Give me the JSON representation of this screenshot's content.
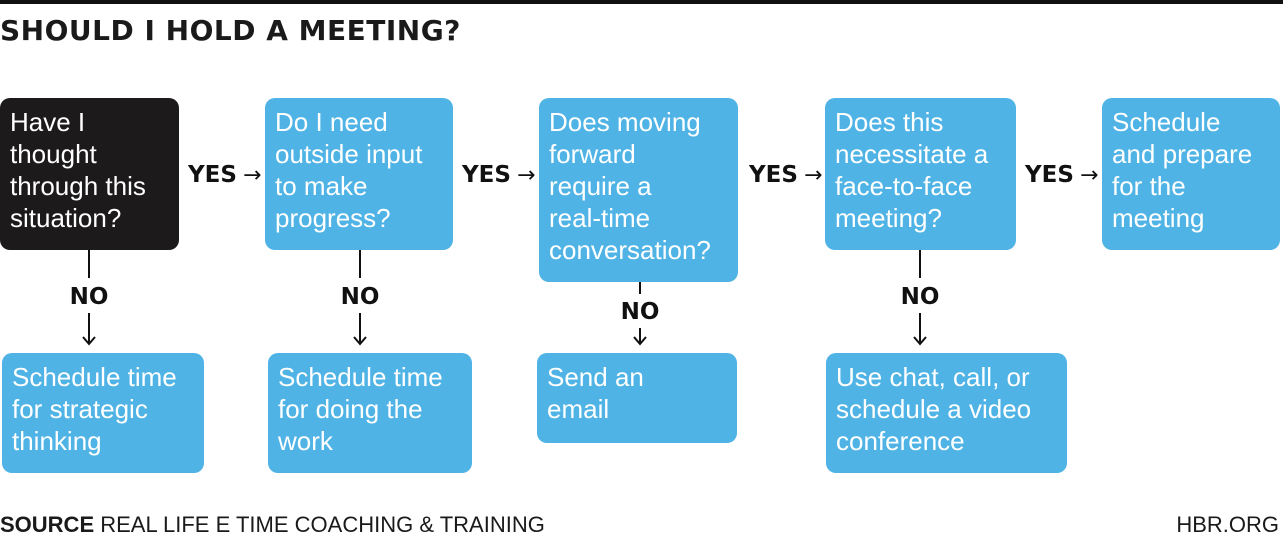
{
  "title": "SHOULD I HOLD A MEETING?",
  "colors": {
    "question_primary": "#1c1a1a",
    "box": "#4fb3e5",
    "text_on_box": "#ffffff",
    "ink": "#111111"
  },
  "questions": [
    {
      "text": "Have I\nthought\nthrough this\nsituation?",
      "no_outcome": "Schedule time\nfor strategic\nthinking"
    },
    {
      "text": "Do I need\noutside input\nto make\nprogress?",
      "no_outcome": "Schedule time\nfor doing the\nwork"
    },
    {
      "text": "Does moving\nforward\nrequire a\nreal-time\nconversation?",
      "no_outcome": "Send an\nemail"
    },
    {
      "text": "Does this\nnecessitate a\nface-to-face\nmeeting?",
      "no_outcome": "Use chat, call, or\nschedule a video\nconference"
    }
  ],
  "final_outcome": "Schedule\nand prepare\nfor the\nmeeting",
  "labels": {
    "yes": "YES",
    "no": "NO",
    "arrow_right": "→"
  },
  "footer": {
    "source_label": "SOURCE",
    "source_text": "REAL LIFE E TIME COACHING & TRAINING",
    "site": "HBR.ORG"
  }
}
